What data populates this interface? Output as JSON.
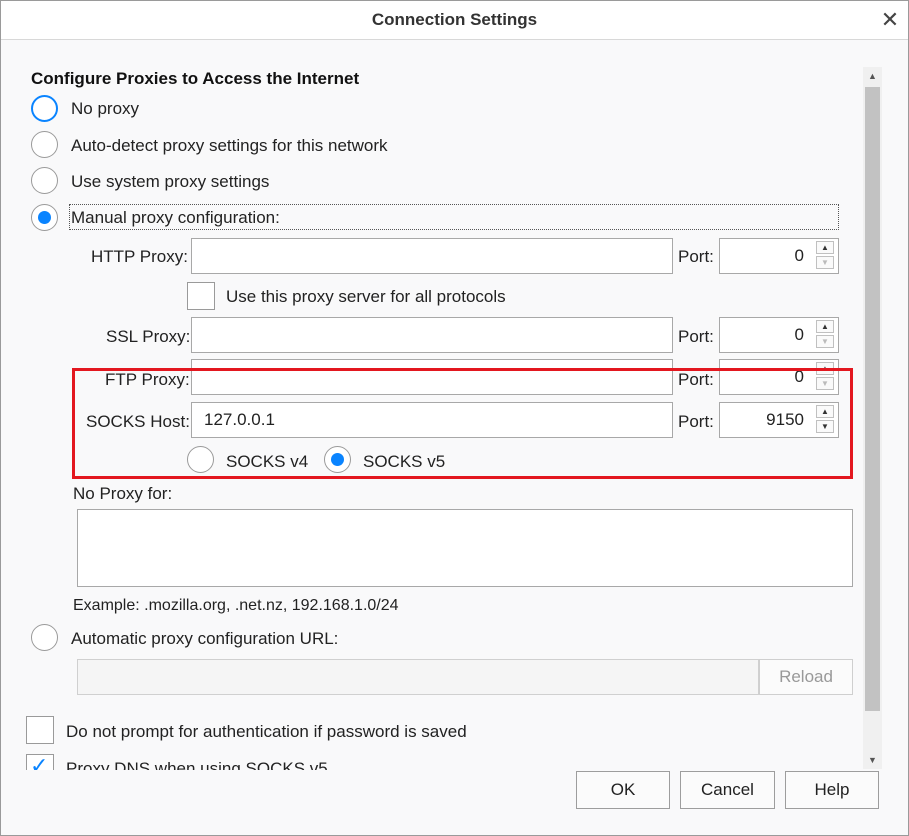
{
  "window": {
    "title": "Connection Settings",
    "close_glyph": "✕"
  },
  "section_heading": "Configure Proxies to Access the Internet",
  "radios": {
    "no_proxy": "No proxy",
    "auto_detect": "Auto-detect proxy settings for this network",
    "system": "Use system proxy settings",
    "manual": "Manual proxy configuration:",
    "auto_url": "Automatic proxy configuration URL:"
  },
  "proxies": {
    "http_label": "HTTP Proxy:",
    "http_value": "",
    "http_port": "0",
    "all_protocols": "Use this proxy server for all protocols",
    "ssl_label": "SSL Proxy:",
    "ssl_value": "",
    "ssl_port": "0",
    "ftp_label": "FTP Proxy:",
    "ftp_value": "",
    "ftp_port": "0",
    "socks_label": "SOCKS Host:",
    "socks_value": "127.0.0.1",
    "socks_port": "9150",
    "port_label": "Port:",
    "socks_v4": "SOCKS v4",
    "socks_v5": "SOCKS v5"
  },
  "no_proxy_for": {
    "label": "No Proxy for:",
    "value": "",
    "example": "Example: .mozilla.org, .net.nz, 192.168.1.0/24"
  },
  "auto_url": {
    "value": "",
    "reload": "Reload"
  },
  "checkboxes": {
    "no_prompt": "Do not prompt for authentication if password is saved",
    "proxy_dns": "Proxy DNS when using SOCKS v5"
  },
  "buttons": {
    "ok": "OK",
    "cancel": "Cancel",
    "help": "Help"
  },
  "colors": {
    "accent": "#0a84ff",
    "highlight": "#e3171f"
  }
}
